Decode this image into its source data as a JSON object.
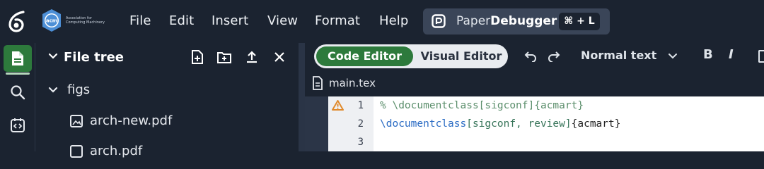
{
  "menu": {
    "acm_text": "Association for Computing Machinery",
    "acm_badge": "acm",
    "items": [
      "File",
      "Edit",
      "Insert",
      "View",
      "Format",
      "Help"
    ],
    "paper_debugger": {
      "label_regular": "Paper",
      "label_bold": "Debugger",
      "shortcut": "⌘ + L"
    }
  },
  "file_tree": {
    "title": "File tree",
    "items": [
      {
        "label": "figs",
        "type": "folder"
      },
      {
        "label": "arch-new.pdf",
        "type": "file"
      },
      {
        "label": "arch.pdf",
        "type": "file"
      }
    ]
  },
  "toolbar": {
    "mode_code": "Code Editor",
    "mode_visual": "Visual Editor",
    "text_style": "Normal text",
    "bold": "B",
    "italic": "I"
  },
  "tab": {
    "filename": "main.tex"
  },
  "editor": {
    "lines": [
      {
        "number": "1",
        "comment": "% \\documentclass[sigconf]{acmart}"
      },
      {
        "number": "2",
        "cmd": "\\documentclass",
        "opt": "[sigconf, review]",
        "arg": "{acmart}"
      },
      {
        "number": "3"
      }
    ]
  },
  "colors": {
    "accent_green": "#2d7a3c",
    "background": "#1b2330",
    "warning": "#e08a2c"
  }
}
